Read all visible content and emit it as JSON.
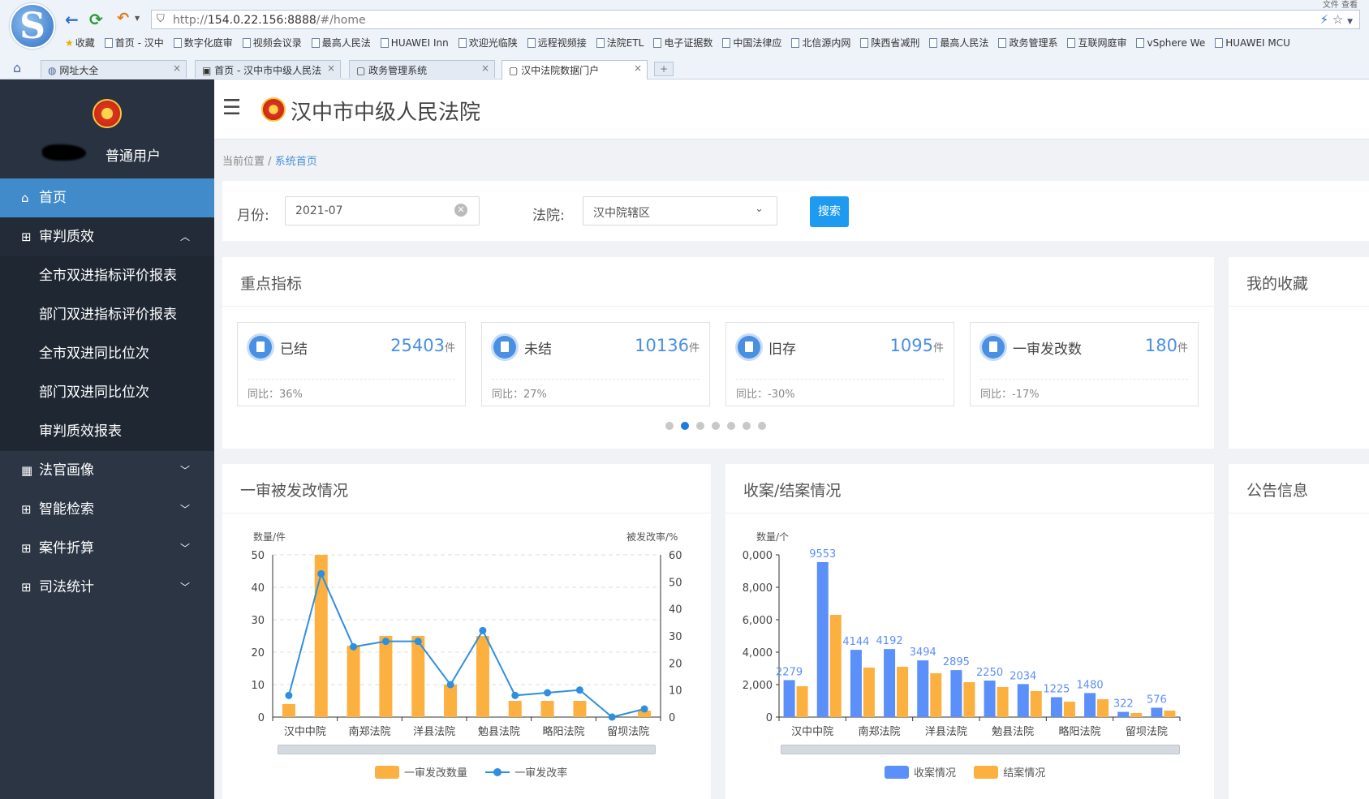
{
  "browser": {
    "logo_letter": "S",
    "url_prefix": "http://",
    "url_host": "154.0.22.156:8888",
    "url_path": "/#/home",
    "top_right_text": "文件 查看",
    "bookmarks": [
      "收藏",
      "首页 - 汉中",
      "数字化庭审",
      "视频会议录",
      "最高人民法",
      "HUAWEI Inn",
      "欢迎光临陕",
      "远程视频接",
      "法院ETL",
      "电子证据数",
      "中国法律应",
      "北信源内网",
      "陕西省减刑",
      "最高人民法",
      "政务管理系",
      "互联网庭审",
      "vSphere We",
      "HUAWEI MCU"
    ],
    "tabs": [
      {
        "label": "网址大全",
        "active": false
      },
      {
        "label": "首页 - 汉中市中级人民法",
        "active": false
      },
      {
        "label": "政务管理系统",
        "active": false
      },
      {
        "label": "汉中法院数据门户",
        "active": true
      }
    ],
    "tab_close": "×",
    "new_tab": "+"
  },
  "sidebar": {
    "user_role": "普通用户",
    "items": [
      {
        "label": "首页",
        "icon": "home-icon",
        "active": true
      },
      {
        "label": "审判质效",
        "icon": "grid-icon",
        "expanded": true
      },
      {
        "label": "法官画像",
        "icon": "dashboard-icon"
      },
      {
        "label": "智能检索",
        "icon": "grid-icon"
      },
      {
        "label": "案件折算",
        "icon": "grid-icon"
      },
      {
        "label": "司法统计",
        "icon": "grid-icon"
      }
    ],
    "subitems": [
      "全市双进指标评价报表",
      "部门双进指标评价报表",
      "全市双进同比位次",
      "部门双进同比位次",
      "审判质效报表"
    ]
  },
  "header": {
    "title": "汉中市中级人民法院"
  },
  "breadcrumb": {
    "root": "当前位置",
    "sep": "/",
    "current": "系统首页"
  },
  "filters": {
    "month_label": "月份:",
    "month_value": "2021-07",
    "court_label": "法院:",
    "court_value": "汉中院辖区",
    "search_label": "搜索"
  },
  "key_indicators": {
    "title": "重点指标",
    "unit": "件",
    "cards": [
      {
        "name": "已结",
        "value": "25403",
        "compare": "同比：36%"
      },
      {
        "name": "未结",
        "value": "10136",
        "compare": "同比：27%"
      },
      {
        "name": "旧存",
        "value": "1095",
        "compare": "同比：-30%"
      },
      {
        "name": "一审发改数",
        "value": "180",
        "compare": "同比：-17%"
      }
    ],
    "carousel_pages": 7,
    "carousel_active": 1
  },
  "favorites": {
    "title": "我的收藏"
  },
  "notices": {
    "title": "公告信息"
  },
  "colors": {
    "bar_orange": "#fbb040",
    "line_blue": "#2e8fe0",
    "bar_blue": "#5b8ff9",
    "sidebar_bg": "#2b3544",
    "active_blue": "#428bca"
  },
  "chart_data": [
    {
      "type": "bar",
      "title": "一审被发改情况",
      "ylabel": "数量/件",
      "y2label": "被发改率/%",
      "ylim": [
        0,
        50
      ],
      "y2lim": [
        0,
        60
      ],
      "yticks": [
        "50",
        "40",
        "30",
        "20",
        "10",
        "0"
      ],
      "y2ticks": [
        "60",
        "50",
        "40",
        "30",
        "20",
        "10",
        "0"
      ],
      "tick_labels": [
        "汉中中院",
        "南郑法院",
        "洋县法院",
        "勉县法院",
        "略阳法院",
        "留坝法院"
      ],
      "categories": [
        "c1",
        "c2",
        "c3",
        "c4",
        "c5",
        "c6",
        "c7",
        "c8",
        "c9",
        "c10",
        "c11",
        "c12"
      ],
      "series": [
        {
          "name": "一审发改数量",
          "type": "bar",
          "axis": "left",
          "values": [
            4,
            50,
            22,
            25,
            25,
            10,
            25,
            5,
            5,
            5,
            0,
            2
          ]
        },
        {
          "name": "一审发改率",
          "type": "line",
          "axis": "right",
          "values": [
            8,
            53,
            26,
            28,
            28,
            12,
            32,
            8,
            9,
            10,
            0,
            3
          ]
        }
      ]
    },
    {
      "type": "bar",
      "title": "收案/结案情况",
      "ylabel": "数量/个",
      "ylim": [
        0,
        10000
      ],
      "yticks": [
        "0,000",
        "8,000",
        "6,000",
        "4,000",
        "2,000",
        "0"
      ],
      "tick_labels": [
        "汉中中院",
        "南郑法院",
        "洋县法院",
        "勉县法院",
        "略阳法院",
        "留坝法院"
      ],
      "categories": [
        "c1",
        "c2",
        "c3",
        "c4",
        "c5",
        "c6",
        "c7",
        "c8",
        "c9",
        "c10",
        "c11",
        "c12"
      ],
      "series": [
        {
          "name": "收案情况",
          "values": [
            2279,
            9553,
            4144,
            4192,
            3494,
            2895,
            2250,
            2034,
            1225,
            1480,
            322,
            576
          ]
        },
        {
          "name": "结案情况",
          "values": [
            1900,
            6300,
            3050,
            3100,
            2700,
            2150,
            1850,
            1600,
            950,
            1100,
            250,
            400
          ]
        }
      ]
    }
  ]
}
